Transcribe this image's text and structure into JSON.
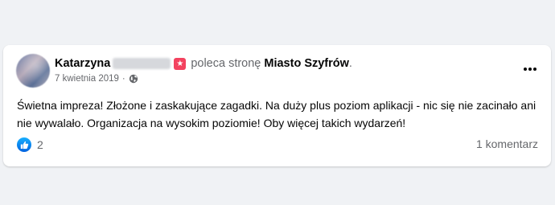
{
  "post": {
    "author_first_name": "Katarzyna",
    "verb": "poleca stronę",
    "page_name": "Miasto Szyfrów",
    "period": ".",
    "date": "7 kwietnia 2019",
    "separator": "·",
    "text": "Świetna impreza! Złożone i zaskakujące zagadki. Na duży plus poziom aplikacji - nic się nie zacinało ani nie wywalało. Organizacja na wysokim poziomie! Oby więcej takich wydarzeń!",
    "reaction_count": "2",
    "comments_label": "1 komentarz"
  },
  "icons": {
    "recommend": "recommend-star-icon",
    "privacy": "globe-icon",
    "menu": "more-options-icon",
    "reaction": "like-icon"
  },
  "colors": {
    "background": "#f0f2f5",
    "card": "#ffffff",
    "text_primary": "#050505",
    "text_secondary": "#65676b",
    "recommend_badge": "#f3425f",
    "like_blue": "#1877f2"
  }
}
